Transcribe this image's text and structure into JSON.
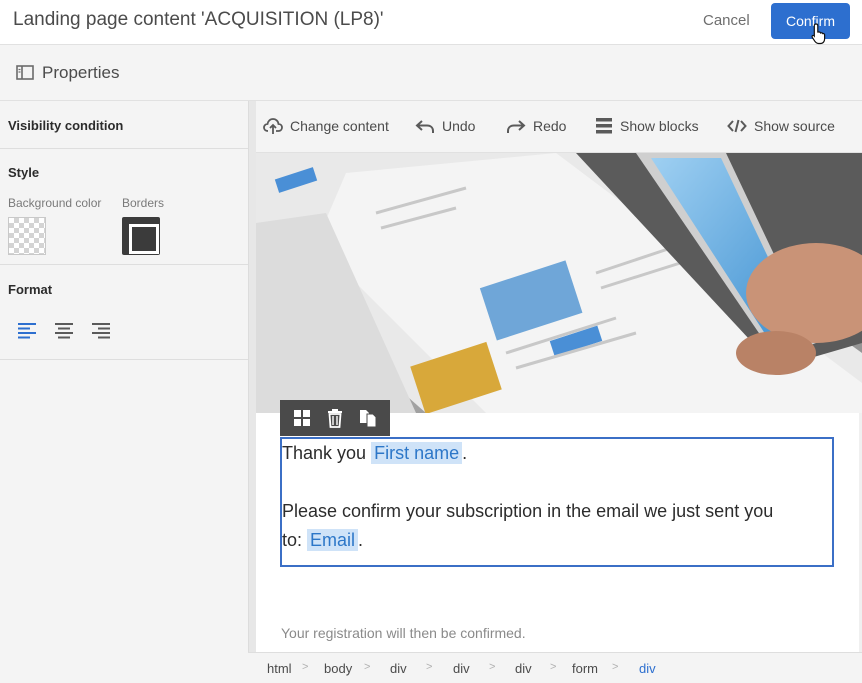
{
  "header": {
    "title": "Landing page content 'ACQUISITION (LP8)'",
    "cancel_label": "Cancel",
    "confirm_label": "Confirm"
  },
  "properties": {
    "label": "Properties",
    "icon": "panel-icon"
  },
  "sidebar": {
    "visibility_heading": "Visibility condition",
    "style_heading": "Style",
    "background_color_label": "Background color",
    "borders_label": "Borders",
    "format_heading": "Format",
    "align_icons": [
      "align-left-icon",
      "align-center-icon",
      "align-right-icon"
    ],
    "selected_align": "left"
  },
  "toolbar": {
    "items": [
      {
        "label": "Change content",
        "icon": "cloud-upload-icon"
      },
      {
        "label": "Undo",
        "icon": "undo-icon"
      },
      {
        "label": "Redo",
        "icon": "redo-icon"
      },
      {
        "label": "Show blocks",
        "icon": "blocks-icon"
      },
      {
        "label": "Show source",
        "icon": "code-icon"
      }
    ]
  },
  "block_toolbar": {
    "icons": [
      "layout-icon",
      "trash-icon",
      "duplicate-icon"
    ]
  },
  "content": {
    "thank_you_text": "Thank you",
    "first_name_field": "First name",
    "period": ".",
    "confirm_text": "Please confirm your subscription in the email we just sent you",
    "to_text": "to:",
    "email_field": "Email",
    "registration_note": "Your registration will then be confirmed."
  },
  "breadcrumb": [
    "html",
    "body",
    "div",
    "div",
    "div",
    "form",
    "div"
  ],
  "colors": {
    "accent": "#2d6fcf",
    "selection_border": "#3b6fc6",
    "personalization_chip_bg": "#cfe3f8"
  }
}
